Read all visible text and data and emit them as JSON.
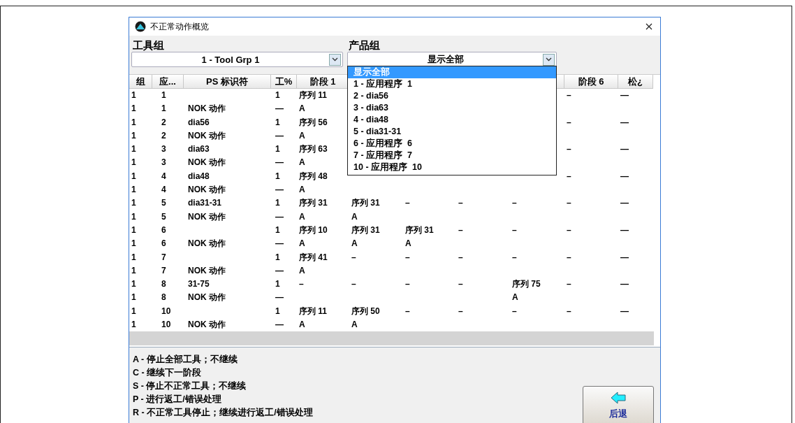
{
  "window": {
    "title": "不正常动作概览"
  },
  "tool_group": {
    "label": "工具组",
    "value": "1 - Tool Grp 1"
  },
  "product_group": {
    "label": "产品组",
    "value": "显示全部",
    "expanded": true,
    "options": [
      {
        "label": "显示全部",
        "selected": true
      },
      {
        "label": "1 - 应用程序  1",
        "selected": false
      },
      {
        "label": "2 - dia56",
        "selected": false
      },
      {
        "label": "3 - dia63",
        "selected": false
      },
      {
        "label": "4 - dia48",
        "selected": false
      },
      {
        "label": "5 - dia31-31",
        "selected": false
      },
      {
        "label": "6 - 应用程序  6",
        "selected": false
      },
      {
        "label": "7 - 应用程序  7",
        "selected": false
      },
      {
        "label": "10 - 应用程序  10",
        "selected": false
      }
    ]
  },
  "table": {
    "columns": [
      {
        "label": "组"
      },
      {
        "label": "应..."
      },
      {
        "label": "PS 标识符"
      },
      {
        "label": "工%"
      },
      {
        "label": "阶段  1"
      },
      {},
      {},
      {},
      {
        "kind": "empty"
      },
      {
        "label": "阶段  6"
      },
      {
        "label": "松¿"
      }
    ],
    "rows": [
      {
        "cells": [
          "1",
          "1",
          "",
          "1",
          "序列 11",
          null,
          null,
          null,
          null,
          "–",
          "—"
        ]
      },
      {
        "cells": [
          "1",
          "1",
          "NOK 动作",
          "—",
          "A",
          null,
          null,
          null,
          null,
          "",
          ""
        ]
      },
      {
        "cells": [
          "1",
          "2",
          "dia56",
          "1",
          "序列 56",
          null,
          null,
          null,
          null,
          "–",
          "—"
        ]
      },
      {
        "cells": [
          "1",
          "2",
          "NOK 动作",
          "—",
          "A",
          null,
          null,
          null,
          null,
          "",
          ""
        ]
      },
      {
        "cells": [
          "1",
          "3",
          "dia63",
          "1",
          "序列 63",
          null,
          null,
          null,
          null,
          "–",
          "—"
        ]
      },
      {
        "cells": [
          "1",
          "3",
          "NOK 动作",
          "—",
          "A",
          null,
          null,
          null,
          null,
          "",
          ""
        ]
      },
      {
        "cells": [
          "1",
          "4",
          "dia48",
          "1",
          "序列 48",
          null,
          null,
          null,
          null,
          "–",
          "—"
        ]
      },
      {
        "cells": [
          "1",
          "4",
          "NOK 动作",
          "—",
          "A",
          "",
          "",
          "",
          "",
          "",
          ""
        ]
      },
      {
        "cells": [
          "1",
          "5",
          "dia31-31",
          "1",
          "序列 31",
          "序列 31",
          "–",
          "–",
          "–",
          "–",
          "—"
        ]
      },
      {
        "cells": [
          "1",
          "5",
          "NOK 动作",
          "—",
          "A",
          "A",
          "",
          "",
          "",
          "",
          ""
        ]
      },
      {
        "cells": [
          "1",
          "6",
          "",
          "1",
          "序列 10",
          "序列 31",
          "序列 31",
          "–",
          "–",
          "–",
          "—"
        ]
      },
      {
        "cells": [
          "1",
          "6",
          "NOK 动作",
          "—",
          "A",
          "A",
          "A",
          "",
          "",
          "",
          ""
        ]
      },
      {
        "cells": [
          "1",
          "7",
          "",
          "1",
          "序列 41",
          "–",
          "–",
          "–",
          "–",
          "–",
          "—"
        ]
      },
      {
        "cells": [
          "1",
          "7",
          "NOK 动作",
          "—",
          "A",
          "",
          "",
          "",
          "",
          "",
          ""
        ]
      },
      {
        "cells": [
          "1",
          "8",
          "31-75",
          "1",
          "–",
          "–",
          "–",
          "–",
          "序列 75",
          "–",
          "—"
        ]
      },
      {
        "cells": [
          "1",
          "8",
          "NOK 动作",
          "—",
          "",
          "",
          "",
          "",
          "A",
          "",
          ""
        ]
      },
      {
        "cells": [
          "1",
          "10",
          "",
          "1",
          "序列 11",
          "序列 50",
          "–",
          "–",
          "–",
          "–",
          "—"
        ]
      },
      {
        "cells": [
          "1",
          "10",
          "NOK 动作",
          "—",
          "A",
          "A",
          "",
          "",
          "",
          "",
          ""
        ]
      }
    ]
  },
  "legend": [
    "A - 停止全部工具；不继续",
    "C - 继续下一阶段",
    "S - 停止不正常工具；不继续",
    "P - 进行返工/错误处理",
    "R - 不正常工具停止；继续进行返工/错误处理"
  ],
  "back_button": {
    "label": "后退"
  }
}
